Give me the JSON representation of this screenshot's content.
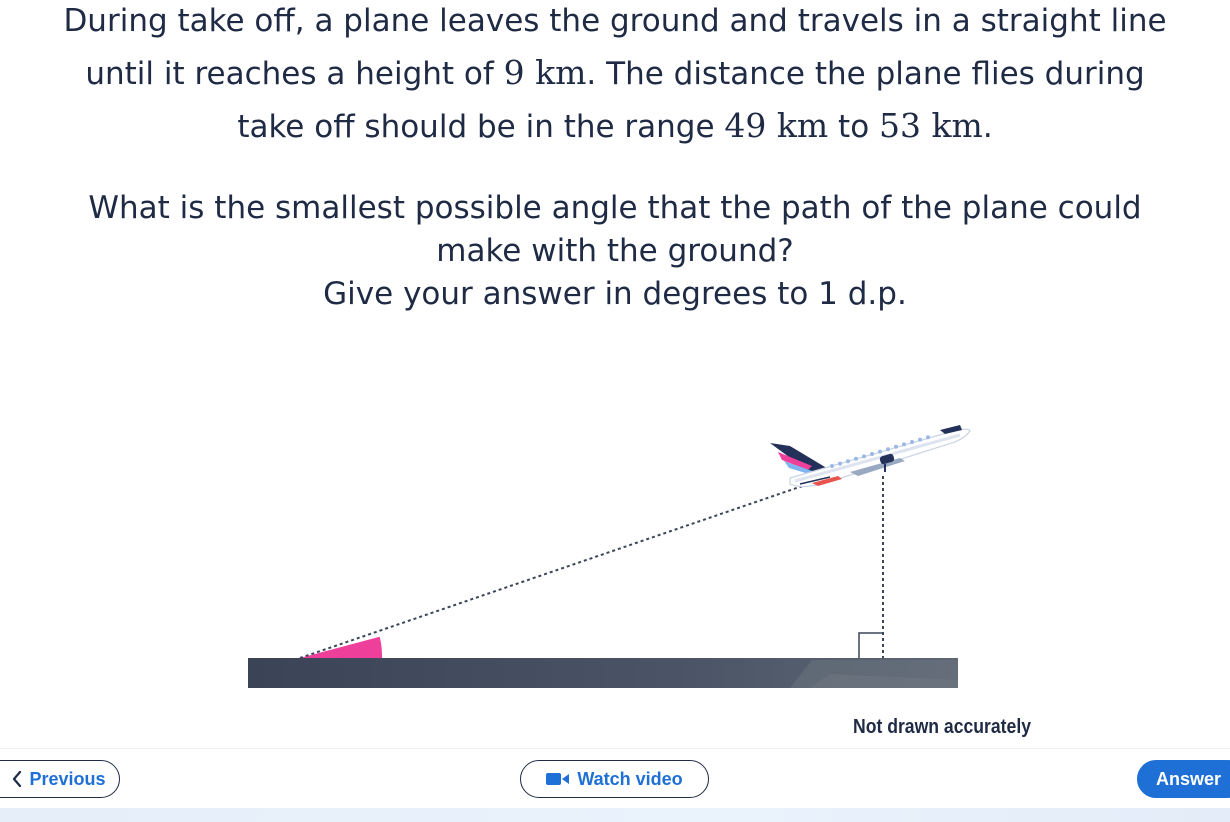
{
  "question": {
    "line1": "During take off, a plane leaves the ground and travels in a straight line",
    "line2_a": "until it reaches a height of ",
    "line2_math": "9 km",
    "line2_b": ". The distance the plane flies during",
    "line3_a": "take off should be in the range ",
    "line3_math1": "49 km",
    "line3_mid": " to ",
    "line3_math2": "53 km",
    "line3_b": ".",
    "ask1": "What is the smallest possible angle that the path of the plane could",
    "ask2": "make with the ground?",
    "ask3": "Give your answer in degrees to 1 d.p."
  },
  "diagram": {
    "note": "Not drawn accurately",
    "angle_color": "#ee3f9b",
    "ground_color": "#3b4557"
  },
  "nav": {
    "previous": "Previous",
    "watch_video": "Watch video",
    "answer": "Answer"
  },
  "colors": {
    "accent": "#1e6fd6",
    "text": "#1f2a44"
  }
}
